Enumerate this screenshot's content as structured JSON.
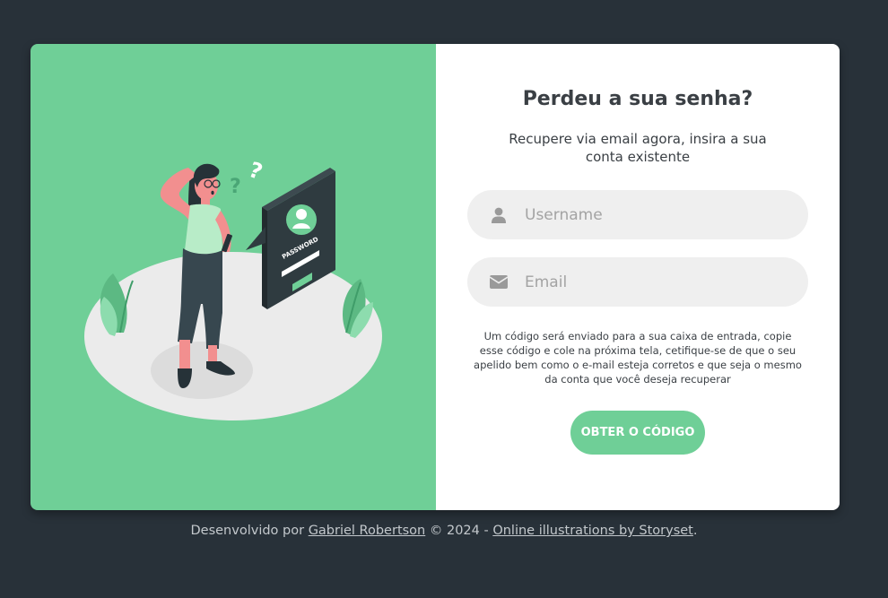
{
  "form": {
    "title": "Perdeu a sua senha?",
    "subtitle": "Recupere via email agora, insira a sua conta existente",
    "username_placeholder": "Username",
    "email_placeholder": "Email",
    "note": "Um código será enviado para a sua caixa de entrada, copie esse código e cole na próxima tela, cetifique-se de que o seu apelido bem como o e-mail esteja corretos e que seja o mesmo da conta que você deseja recuperar",
    "submit_label": "OBTER O CÓDIGO"
  },
  "illustration": {
    "device_label": "PASSWORD",
    "question_marks": [
      "?",
      "?"
    ]
  },
  "footer": {
    "prefix": "Desenvolvido por",
    "author": "Gabriel Robertson",
    "copyright": "© 2024 -",
    "credit": "Online illustrations by Storyset",
    "suffix": "."
  },
  "colors": {
    "background": "#283139",
    "accent": "#6fcf97",
    "card": "#ffffff",
    "input_bg": "#efefef",
    "text_dark": "#3a3f44"
  },
  "icons": {
    "username": "user-icon",
    "email": "envelope-icon"
  }
}
